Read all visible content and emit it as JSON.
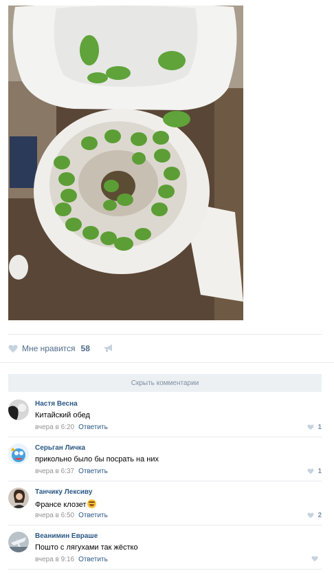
{
  "post": {
    "photo": {
      "icon": "toilet-frogs-photo"
    },
    "like_label": "Мне нравится",
    "like_count": "58"
  },
  "comments_toggle": "Скрыть комментарии",
  "comments": [
    {
      "author": "Настя Весна",
      "text": "Китайский обед",
      "time": "вчера в 6:20",
      "reply": "Ответить",
      "likes": "1"
    },
    {
      "author": "Серьган Личка",
      "text": "прикольно было бы посрать на них",
      "time": "вчера в 6:37",
      "reply": "Ответить",
      "likes": "1"
    },
    {
      "author": "Танчику Лексиву",
      "text": "Франсе клозет",
      "time": "вчера в 6:50",
      "reply": "Ответить",
      "likes": "2"
    },
    {
      "author": "Веанимин Евраше",
      "text": "Пошто с лягухами так жёстко",
      "time": "вчера в 9:16",
      "reply": "Ответить",
      "likes": ""
    }
  ],
  "colors": {
    "link": "#2a5885",
    "meta": "#939393",
    "toggle_bg": "#ecf0f3"
  }
}
